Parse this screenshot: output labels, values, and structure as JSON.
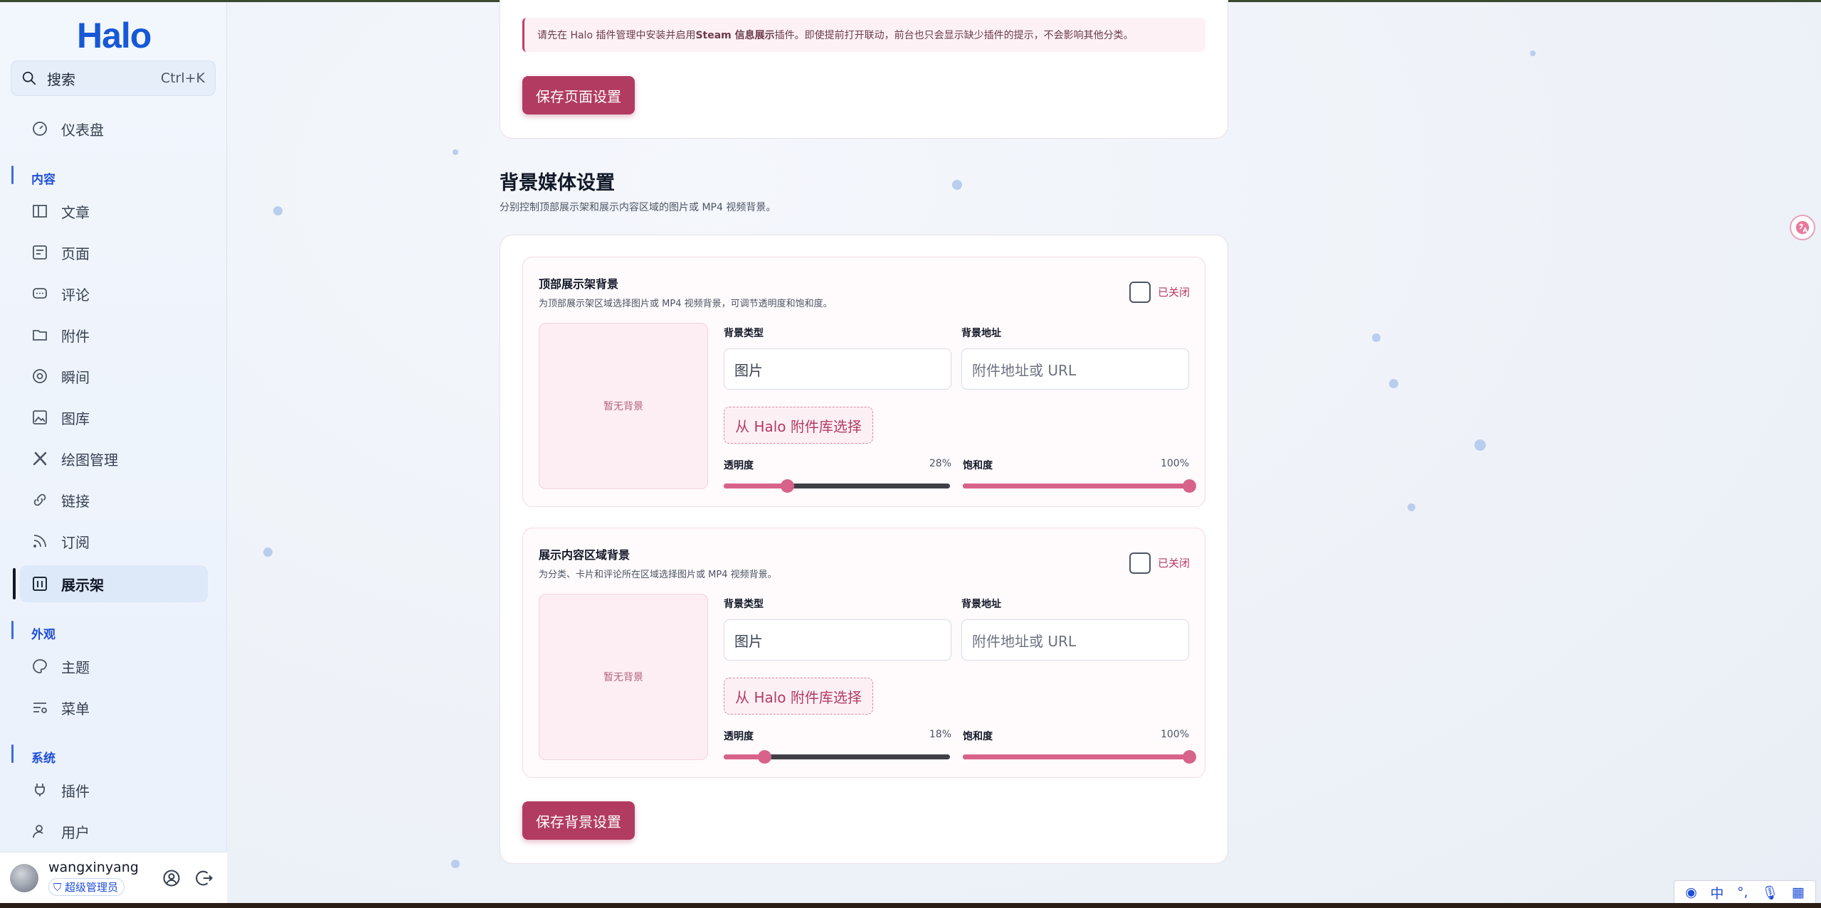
{
  "app": {
    "logo": "Halo"
  },
  "search": {
    "label": "搜索",
    "shortcut": "Ctrl+K"
  },
  "sidebar": {
    "dashboard": "仪表盘",
    "sections": {
      "content": "内容",
      "appearance": "外观",
      "system": "系统"
    },
    "items": {
      "posts": "文章",
      "pages": "页面",
      "comments": "评论",
      "attachments": "附件",
      "moments": "瞬间",
      "gallery": "图库",
      "drawing": "绘图管理",
      "links": "链接",
      "subscriptions": "订阅",
      "showcase": "展示架",
      "themes": "主题",
      "menus": "菜单",
      "plugins": "插件",
      "users": "用户"
    },
    "active_item": "showcase"
  },
  "user": {
    "name": "wangxinyang",
    "role": "超级管理员"
  },
  "page_settings": {
    "notice_prefix": "请先在 Halo 插件管理中安装并启用 ",
    "notice_plugin": "Steam 信息展示",
    "notice_suffix": " 插件。即使提前打开联动，前台也只会显示缺少插件的提示，不会影响其他分类。",
    "save_label": "保存页面设置"
  },
  "background_media": {
    "heading": "背景媒体设置",
    "description": "分别控制顶部展示架和展示内容区域的图片或 MP4 视频背景。",
    "panels": [
      {
        "title": "顶部展示架背景",
        "description": "为顶部展示架区域选择图片或 MP4 视频背景，可调节透明度和饱和度。",
        "toggle_label": "已关闭",
        "enabled": false,
        "preview_text": "暂无背景",
        "type_label": "背景类型",
        "type_value": "图片",
        "url_label": "背景地址",
        "url_placeholder": "附件地址或 URL",
        "pick_label": "从 Halo 附件库选择",
        "opacity_label": "透明度",
        "opacity_value": "28%",
        "opacity": 28,
        "saturation_label": "饱和度",
        "saturation_value": "100%",
        "saturation": 100
      },
      {
        "title": "展示内容区域背景",
        "description": "为分类、卡片和评论所在区域选择图片或 MP4 视频背景。",
        "toggle_label": "已关闭",
        "enabled": false,
        "preview_text": "暂无背景",
        "type_label": "背景类型",
        "type_value": "图片",
        "url_label": "背景地址",
        "url_placeholder": "附件地址或 URL",
        "pick_label": "从 Halo 附件库选择",
        "opacity_label": "透明度",
        "opacity_value": "18%",
        "opacity": 18,
        "saturation_label": "饱和度",
        "saturation_value": "100%",
        "saturation": 100
      }
    ],
    "save_label": "保存背景设置"
  },
  "ime": {
    "mode": "中"
  },
  "colors": {
    "accent": "#b23b62",
    "slider": "#d8638a",
    "brand": "#1658d6"
  }
}
